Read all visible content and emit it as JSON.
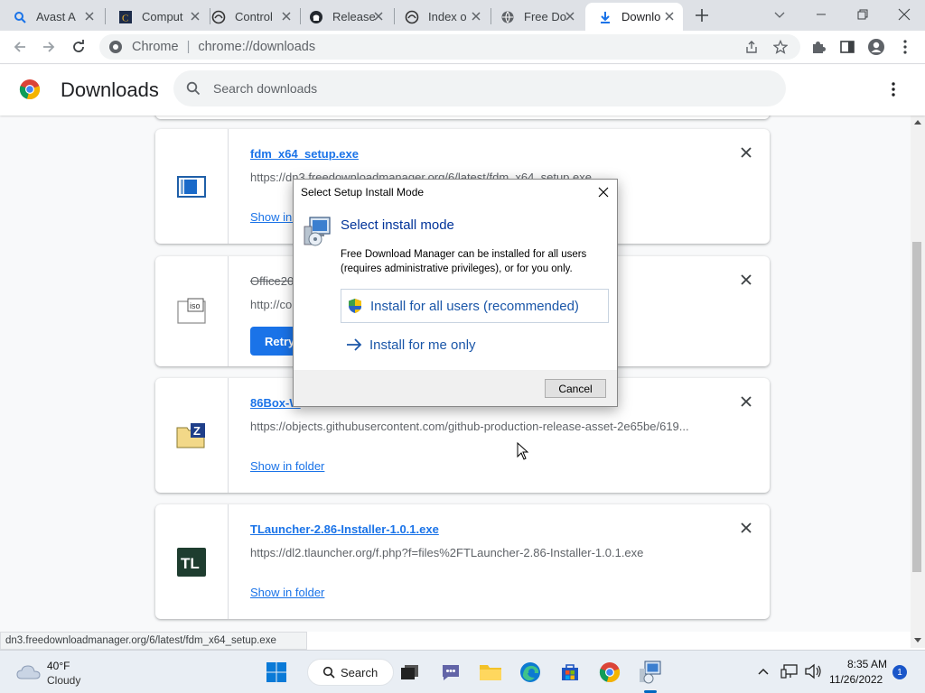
{
  "tabs": [
    {
      "label": "Avast A",
      "icon": "search-icon"
    },
    {
      "label": "Comput",
      "icon": "c-logo-icon"
    },
    {
      "label": "Control",
      "icon": "crane-icon"
    },
    {
      "label": "Release",
      "icon": "github-icon"
    },
    {
      "label": "Index o",
      "icon": "crane-icon"
    },
    {
      "label": "Free Do",
      "icon": "globe-icon"
    },
    {
      "label": "Downlo",
      "icon": "download-icon"
    }
  ],
  "toolbar": {
    "site_label": "Chrome",
    "url": "chrome://downloads"
  },
  "downloads": {
    "title": "Downloads",
    "search_placeholder": "Search downloads",
    "items": [
      {
        "name": "fdm_x64_setup.exe",
        "url": "https://dn3.freedownloadmanager.org/6/latest/fdm_x64_setup.exe",
        "action": "Show in folder"
      },
      {
        "name": "Office20",
        "url": "http://co",
        "action": "Retry"
      },
      {
        "name": "86Box-W",
        "url": "https://objects.githubusercontent.com/github-production-release-asset-2e65be/619...",
        "action": "Show in folder"
      },
      {
        "name": "TLauncher-2.86-Installer-1.0.1.exe",
        "url": "https://dl2.tlauncher.org/f.php?f=files%2FTLauncher-2.86-Installer-1.0.1.exe",
        "action": "Show in folder"
      }
    ],
    "status_url": "dn3.freedownloadmanager.org/6/latest/fdm_x64_setup.exe"
  },
  "dialog": {
    "title": "Select Setup Install Mode",
    "heading": "Select install mode",
    "description": "Free Download Manager can be installed for all users (requires administrative privileges), or for you only.",
    "option_all": "Install for all users (recommended)",
    "option_me": "Install for me only",
    "cancel": "Cancel"
  },
  "taskbar": {
    "temp": "40°F",
    "weather": "Cloudy",
    "search_label": "Search",
    "time": "8:35 AM",
    "date": "11/26/2022",
    "notifications": "1"
  },
  "colors": {
    "accent": "#1a73e8",
    "dialog_link": "#1a56a8",
    "tlauncher_tile": "#1e3d2f"
  }
}
